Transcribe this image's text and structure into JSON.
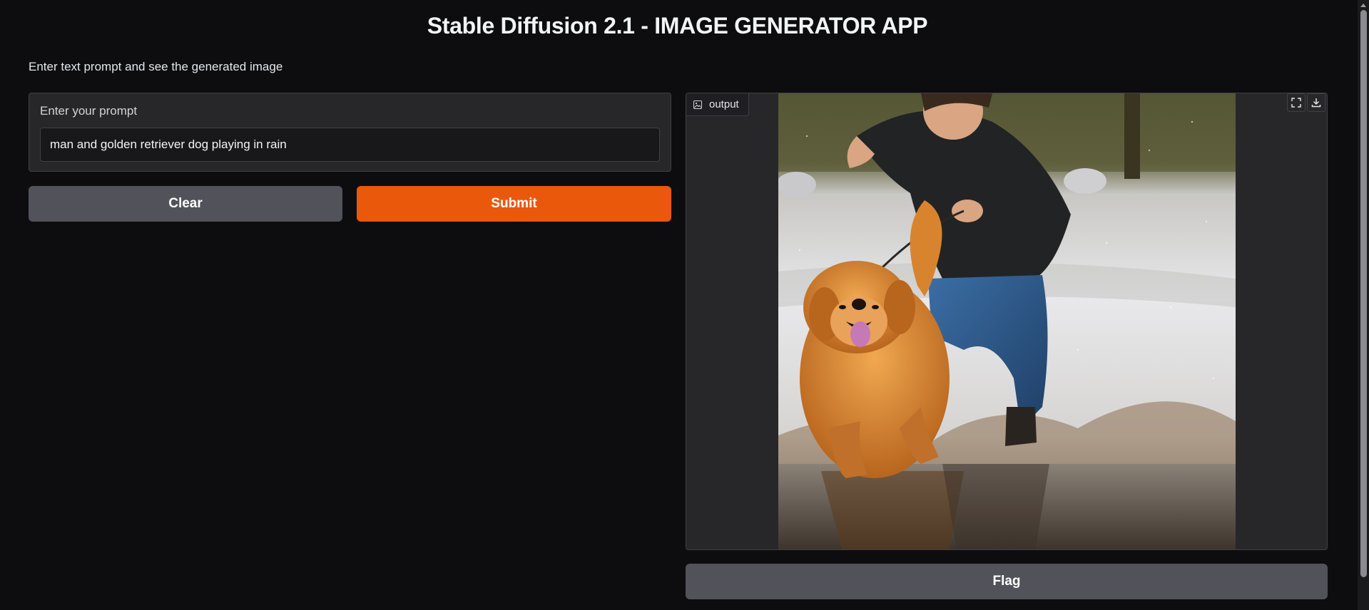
{
  "header": {
    "title": "Stable Diffusion 2.1 - IMAGE GENERATOR APP",
    "subtitle": "Enter text prompt and see the generated image"
  },
  "prompt": {
    "label": "Enter your prompt",
    "value": "man and golden retriever dog playing in rain"
  },
  "buttons": {
    "clear_label": "Clear",
    "submit_label": "Submit",
    "flag_label": "Flag"
  },
  "output": {
    "label": "output",
    "image_icon": "image-icon",
    "fullscreen_icon": "fullscreen-icon",
    "download_icon": "download-icon",
    "image_alt": "man and golden retriever dog playing in rain"
  },
  "colors": {
    "background": "#0d0d10",
    "panel": "#27272a",
    "accent": "#ea580c",
    "secondary_button": "#52525b"
  }
}
